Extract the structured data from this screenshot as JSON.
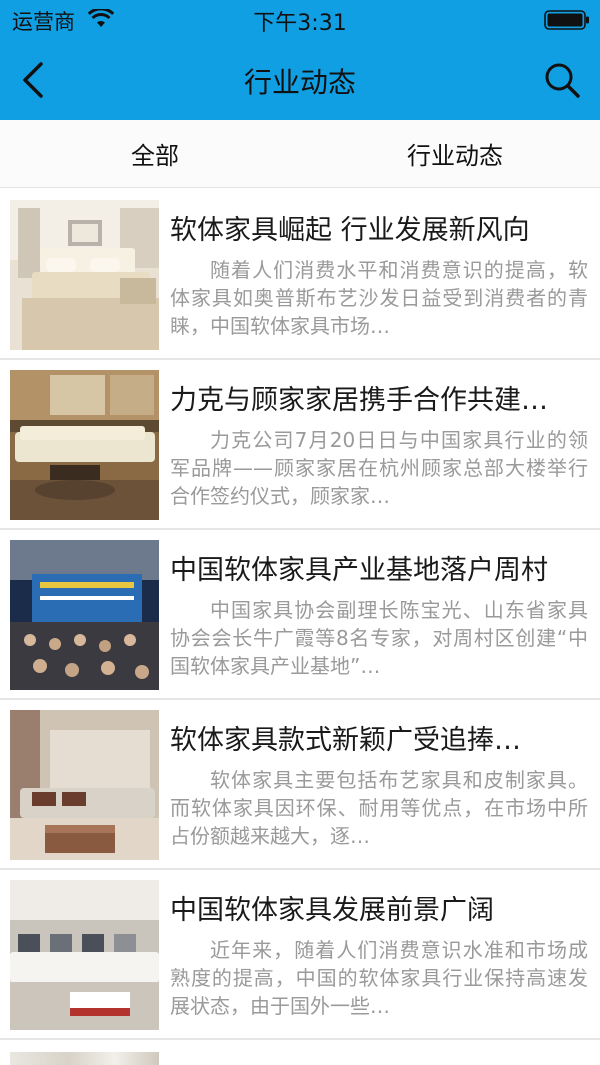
{
  "status_bar": {
    "carrier": "运营商",
    "time": "下午3:31"
  },
  "nav": {
    "title": "行业动态",
    "back_icon": "chevron-left-icon",
    "search_icon": "search-icon"
  },
  "tabs": [
    {
      "label": "全部"
    },
    {
      "label": "行业动态"
    }
  ],
  "colors": {
    "header": "#119fe3",
    "title_text": "#1a1a1a",
    "summary_text": "#9a9a9a",
    "divider": "#e6e6e6"
  },
  "articles": [
    {
      "title": "软体家具崛起 行业发展新风向",
      "summary": "随着人们消费水平和消费意识的提高，软体家具如奥普斯布艺沙发日益受到消费者的青睐，中国软体家具市场…"
    },
    {
      "title": "力克与顾家家居携手合作共建…",
      "summary": "力克公司7月20日日与中国家具行业的领军品牌——顾家家居在杭州顾家总部大楼举行合作签约仪式，顾家家…"
    },
    {
      "title": "中国软体家具产业基地落户周村",
      "summary": "中国家具协会副理长陈宝光、山东省家具协会会长牛广霞等8名专家，对周村区创建“中国软体家具产业基地”…"
    },
    {
      "title": "软体家具款式新颖广受追捧…",
      "summary": "软体家具主要包括布艺家具和皮制家具。而软体家具因环保、耐用等优点，在市场中所占份额越来越大，逐…"
    },
    {
      "title": "中国软体家具发展前景广阔",
      "summary": "近年来，随着人们消费意识水准和市场成熟度的提高，中国的软体家具行业保持高速发展状态，由于国外一些…"
    }
  ]
}
